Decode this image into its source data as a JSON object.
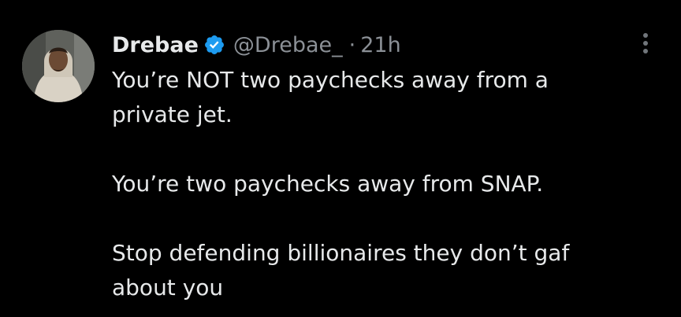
{
  "tweet": {
    "display_name": "Drebae",
    "handle": "@Drebae_",
    "separator": "·",
    "time": "21h",
    "verified_icon": "verified-badge-icon",
    "more_icon": "more-options-icon",
    "verified_color": "#1d9bf0",
    "paragraphs": [
      {
        "lines": [
          "You’re NOT two paychecks away from a",
          "private jet."
        ]
      },
      {
        "lines": [
          "You’re two paychecks away from SNAP."
        ]
      },
      {
        "lines": [
          "Stop defending billionaires they don’t gaf",
          "about you"
        ]
      }
    ]
  }
}
